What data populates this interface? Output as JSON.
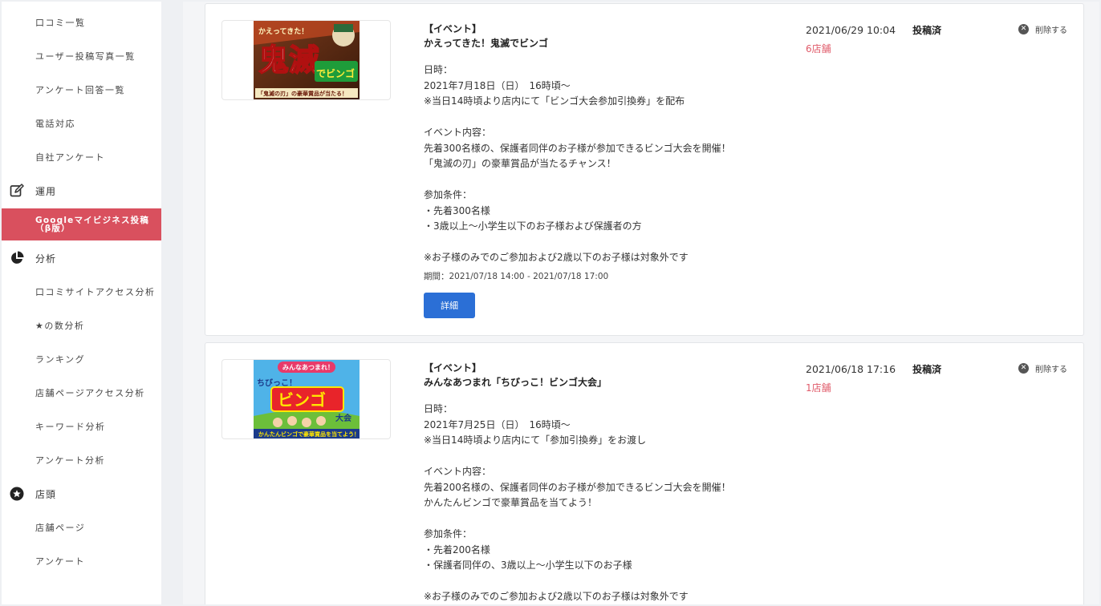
{
  "sidebar": {
    "items": [
      {
        "label": "口コミ一覧"
      },
      {
        "label": "ユーザー投稿写真一覧"
      },
      {
        "label": "アンケート回答一覧"
      },
      {
        "label": "電話対応"
      },
      {
        "label": "自社アンケート"
      },
      {
        "label": "運用",
        "icon": "edit-icon"
      },
      {
        "label": "Googleマイビジネス投稿（β版）"
      },
      {
        "label": "分析",
        "icon": "pie-chart-icon"
      },
      {
        "label": "口コミサイトアクセス分析"
      },
      {
        "label": "★の数分析"
      },
      {
        "label": "ランキング"
      },
      {
        "label": "店舗ページアクセス分析"
      },
      {
        "label": "キーワード分析"
      },
      {
        "label": "アンケート分析"
      },
      {
        "label": "店頭",
        "icon": "store-badge-icon"
      },
      {
        "label": "店舗ページ"
      },
      {
        "label": "アンケート"
      }
    ],
    "active_color": "#d9505e"
  },
  "posts": [
    {
      "type": "【イベント】",
      "title": "かえってきた！鬼滅でビンゴ",
      "lines": [
        "日時：",
        "2021年7月18日（日）　16時頃〜",
        "※当日14時頃より店内にて「ビンゴ大会参加引換券」を配布",
        "",
        "イベント内容：",
        "先着300名様の、保護者同伴のお子様が参加できるビンゴ大会を開催！",
        "「鬼滅の刃」の豪華賞品が当たるチャンス！",
        "",
        "参加条件：",
        "・先着300名様",
        "・3歳以上〜小学生以下のお子様および保護者の方",
        "",
        "※お子様のみでのご参加および2歳以下のお子様は対象外です"
      ],
      "period": "期間：2021/07/18 14:00 - 2021/07/18 17:00",
      "detail_label": "詳細",
      "date": "2021/06/29 10:04",
      "status": "投稿済",
      "stores": "6店舗",
      "delete_label": "削除する",
      "thumb": {
        "top": "かえってきた！",
        "big1": "鬼滅",
        "big2": "でビンゴ",
        "bottom": "「鬼滅の刃」の豪華賞品が当たる！"
      }
    },
    {
      "type": "【イベント】",
      "title": "みんなあつまれ「ちびっこ！ビンゴ大会」",
      "lines": [
        "日時：",
        "2021年7月25日（日）　16時頃〜",
        "※当日14時頃より店内にて「参加引換券」をお渡し",
        "",
        "イベント内容：",
        "先着200名様の、保護者同伴のお子様が参加できるビンゴ大会を開催！",
        "かんたんビンゴで豪華賞品を当てよう！",
        "",
        "参加条件：",
        "・先着200名様",
        "・保護者同伴の、3歳以上〜小学生以下のお子様",
        "",
        "※お子様のみでのご参加および2歳以下のお子様は対象外です"
      ],
      "date": "2021/06/18 17:16",
      "status": "投稿済",
      "stores": "1店舗",
      "delete_label": "削除する",
      "thumb": {
        "top": "みんなあつまれ！",
        "big1": "ちびっこ！",
        "big2": "ビンゴ",
        "tag": "大会",
        "bottom": "かんたんビンゴで豪華賞品を当てよう！"
      }
    }
  ]
}
